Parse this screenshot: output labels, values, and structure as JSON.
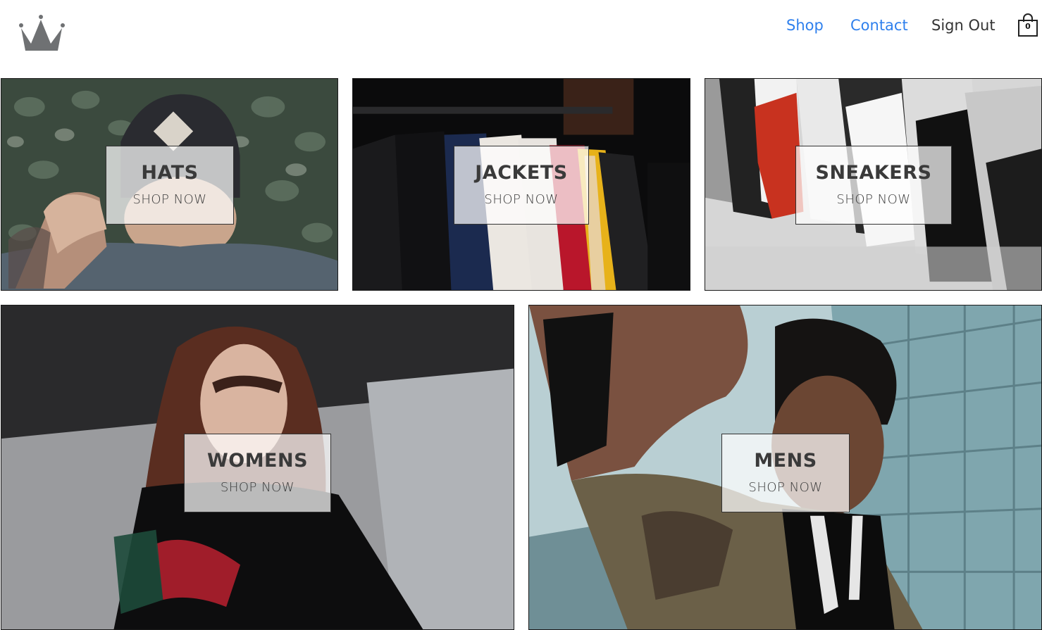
{
  "header": {
    "logo_icon": "crown-icon",
    "nav": {
      "shop_label": "Shop",
      "contact_label": "Contact",
      "signout_label": "Sign Out"
    },
    "cart": {
      "icon": "shopping-bag-icon",
      "count": "0"
    },
    "colors": {
      "link_active": "#2f80ed",
      "link_default": "#333333"
    }
  },
  "categories": [
    {
      "title": "HATS",
      "cta": "SHOP NOW"
    },
    {
      "title": "JACKETS",
      "cta": "SHOP NOW"
    },
    {
      "title": "SNEAKERS",
      "cta": "SHOP NOW"
    },
    {
      "title": "WOMENS",
      "cta": "SHOP NOW"
    },
    {
      "title": "MENS",
      "cta": "SHOP NOW"
    }
  ]
}
